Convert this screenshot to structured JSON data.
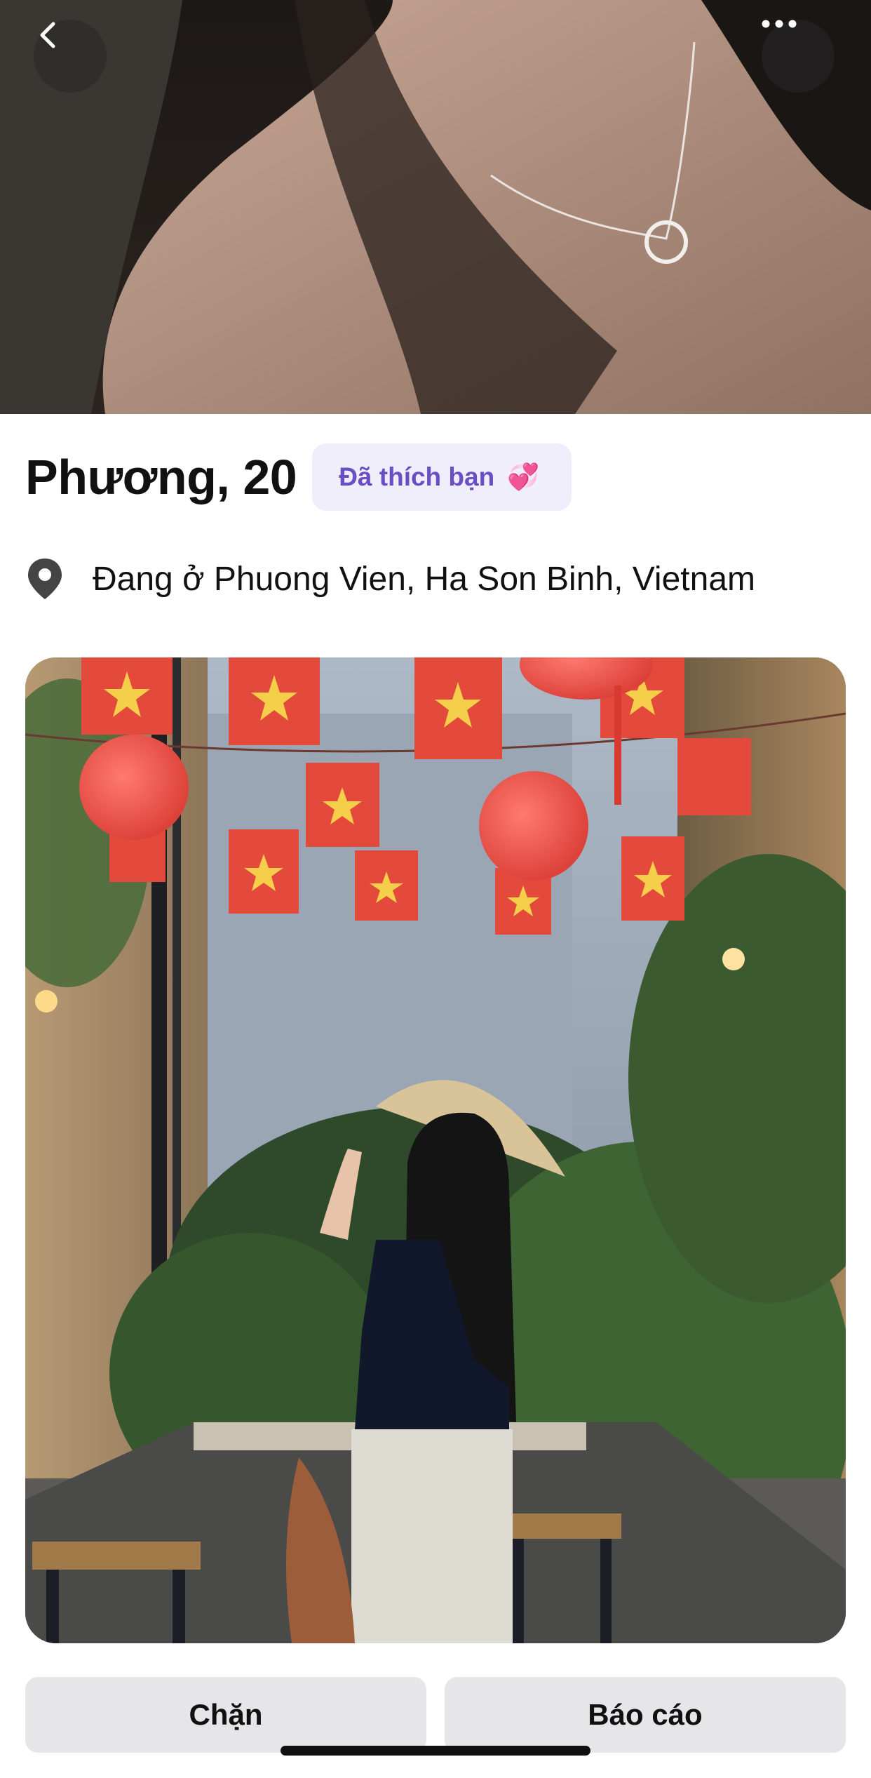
{
  "profile": {
    "name_age": "Phương, 20",
    "liked_badge": "Đã thích bạn",
    "liked_emoji": "💞",
    "location": "Đang ở Phuong Vien, Ha Son Binh, Vietnam"
  },
  "icons": {
    "back": "chevron-left-icon",
    "more": "more-horizontal-icon",
    "location": "map-pin-icon"
  },
  "actions": {
    "block_label": "Chặn",
    "report_label": "Báo cáo"
  },
  "colors": {
    "badge_bg": "#f1eefc",
    "badge_text": "#6a4fc4",
    "button_bg": "#e6e6e9"
  }
}
